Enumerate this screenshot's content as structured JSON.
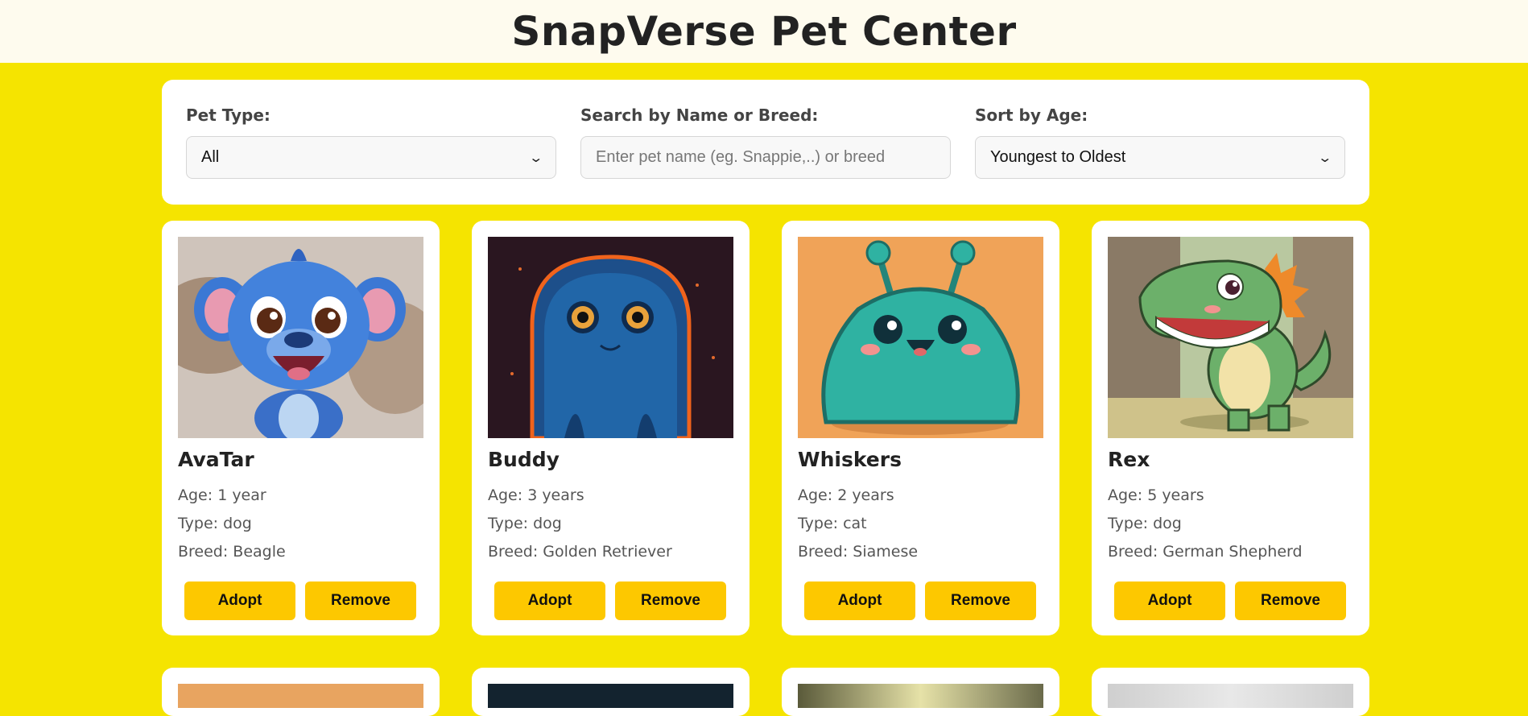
{
  "header": {
    "title": "SnapVerse Pet Center"
  },
  "filters": {
    "pet_type_label": "Pet Type:",
    "pet_type_value": "All",
    "search_label": "Search by Name or Breed:",
    "search_placeholder": "Enter pet name (eg. Snappie,..) or breed",
    "sort_label": "Sort by Age:",
    "sort_value": "Youngest to Oldest"
  },
  "pets": [
    {
      "name": "AvaTar",
      "age": "Age: 1 year",
      "type": "Type: dog",
      "breed": "Breed: Beagle",
      "adopt": "Adopt",
      "remove": "Remove",
      "image": "blue-furry-creature"
    },
    {
      "name": "Buddy",
      "age": "Age: 3 years",
      "type": "Type: dog",
      "breed": "Breed: Golden Retriever",
      "adopt": "Adopt",
      "remove": "Remove",
      "image": "glowing-blue-blob"
    },
    {
      "name": "Whiskers",
      "age": "Age: 2 years",
      "type": "Type: cat",
      "breed": "Breed: Siamese",
      "adopt": "Adopt",
      "remove": "Remove",
      "image": "green-slime-alien"
    },
    {
      "name": "Rex",
      "age": "Age: 5 years",
      "type": "Type: dog",
      "breed": "Breed: German Shepherd",
      "adopt": "Adopt",
      "remove": "Remove",
      "image": "cartoon-dinosaur"
    }
  ],
  "colors": {
    "page_bg": "#f5e400",
    "header_bg": "#fefbee",
    "button": "#fdc800"
  }
}
